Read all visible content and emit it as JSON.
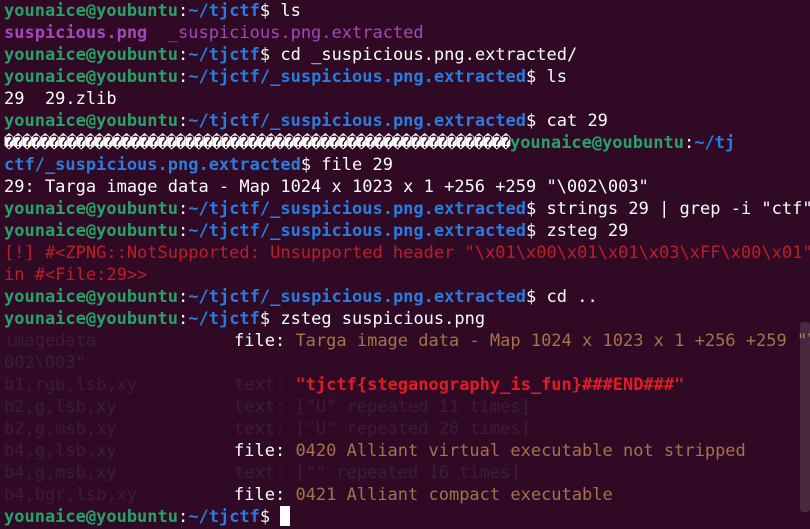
{
  "prompt": {
    "user": "younaice@youbuntu",
    "colon": ":",
    "path_home": "~/tjctf",
    "path_extracted": "~/tjctf/_suspicious.png.extracted",
    "symbol": "$ "
  },
  "lines": {
    "cmd1": "ls",
    "out1a": "suspicious.png",
    "out1b": "  _suspicious.png.extracted",
    "cmd2": "cd _suspicious.png.extracted/",
    "cmd3": "ls",
    "out3": "29  29.zlib",
    "cmd4": "cat 29",
    "garbage": "��������������������������������������������������������",
    "wrap_user": "younaice@youbuntu",
    "wrap_colon": ":",
    "wrap_path_a": "~/tj",
    "wrap_path_b": "ctf/_suspicious.png.extracted",
    "cmd5": "file 29",
    "out5": "29: Targa image data - Map 1024 x 1023 x 1 +256 +259 \"\\002\\003\"",
    "cmd6": "strings 29 | grep -i \"ctf\"",
    "cmd7": "zsteg 29",
    "err1": "[!] #<ZPNG::NotSupported: Unsupported header \"\\x01\\x00\\x01\\x01\\x03\\xFF\\x00\\x01\"",
    "err2": "in #<File:29>>",
    "cmd8": "cd ..",
    "cmd9": "zsteg suspicious.png"
  },
  "zsteg": {
    "r1_key": "imagedata",
    "r1_label": "file:",
    "r1_val": "Targa image data - Map 1024 x 1023 x 1 +256 +259 \"\\",
    "r1_wrap": "002\\003\"",
    "r2_key": "b1,rgb,lsb,xy",
    "r2_label": "text:",
    "r2_val": "\"tjctf{steganography_is_fun}###END###\"",
    "r3_key": "b2,g,lsb,xy",
    "r3_label": "text:",
    "r3_val": "[\"U\" repeated 11 times]",
    "r4_key": "b2,g,msb,xy",
    "r4_label": "text:",
    "r4_val": "[\"U\" repeated 28 times]",
    "r5_key": "b4,g,lsb,xy",
    "r5_label": "file:",
    "r5_val": "0420 Alliant virtual executable not stripped",
    "r6_key": "b4,g,msb,xy",
    "r6_label": "text:",
    "r6_val": "[\"\" repeated 16 times]",
    "r7_key": "b4,bgr,lsb,xy",
    "r7_label": "file:",
    "r7_val": "0421 Alliant compact executable"
  },
  "colors": {
    "background": "#300a24",
    "user": "#26a269",
    "path": "#2a7bde",
    "error": "#c01c28",
    "flag": "#e01b24",
    "file_desc": "#a2734c"
  }
}
